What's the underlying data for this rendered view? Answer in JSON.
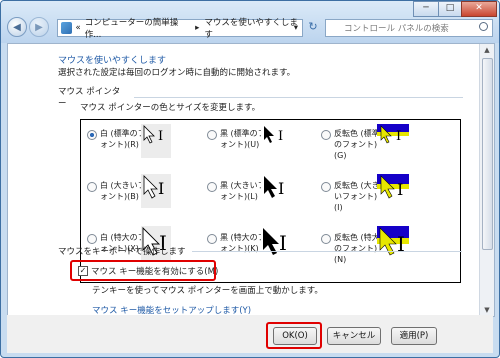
{
  "window": {
    "minimize": "─",
    "maximize": "□",
    "close": "✕"
  },
  "nav": {
    "back_icon": "◀",
    "forward_icon": "▶",
    "breadcrumb_prefix": "«",
    "breadcrumb_1": "コンピューターの簡単操作...",
    "breadcrumb_sep": "▸",
    "breadcrumb_2": "マウスを使いやすくします",
    "dropdown": "▾",
    "refresh": "↻",
    "search_placeholder": "コントロール パネルの検索"
  },
  "page": {
    "heading": "マウスを使いやすくします",
    "subtext": "選択された設定は毎回のログオン時に自動的に開始されます。",
    "pointer_section": "マウス ポインター",
    "pointer_desc": "マウス ポインターの色とサイズを変更します。",
    "options": [
      {
        "line1": "白 (標準のフ",
        "line2": "ォント)(R)",
        "selected": true
      },
      {
        "line1": "黒 (標準のフ",
        "line2": "ォント)(U)",
        "selected": false
      },
      {
        "line1": "反転色 (標準",
        "line2": "のフォント)",
        "line3": "(G)",
        "selected": false
      },
      {
        "line1": "白 (大きいフ",
        "line2": "ォント)(B)",
        "selected": false
      },
      {
        "line1": "黒 (大きいフ",
        "line2": "ォント)(L)",
        "selected": false
      },
      {
        "line1": "反転色 (大き",
        "line2": "いフォント)",
        "line3": "(I)",
        "selected": false
      },
      {
        "line1": "白 (特大のフ",
        "line2": "ォント)(X)",
        "selected": false
      },
      {
        "line1": "黒 (特大のフ",
        "line2": "ォント)(K)",
        "selected": false
      },
      {
        "line1": "反転色 (特大",
        "line2": "のフォント)",
        "line3": "(N)",
        "selected": false
      }
    ],
    "keyboard_section": "マウスをキーボードで操作します",
    "mousekeys_checkbox": "マウス キー機能を有効にする(M)",
    "mousekeys_checked": true,
    "mousekeys_desc": "テンキーを使ってマウス ポインターを画面上で動かします。",
    "setup_link": "マウス キー機能をセットアップします(Y)"
  },
  "buttons": {
    "ok": "OK(O)",
    "cancel": "キャンセル",
    "apply": "適用(P)"
  }
}
